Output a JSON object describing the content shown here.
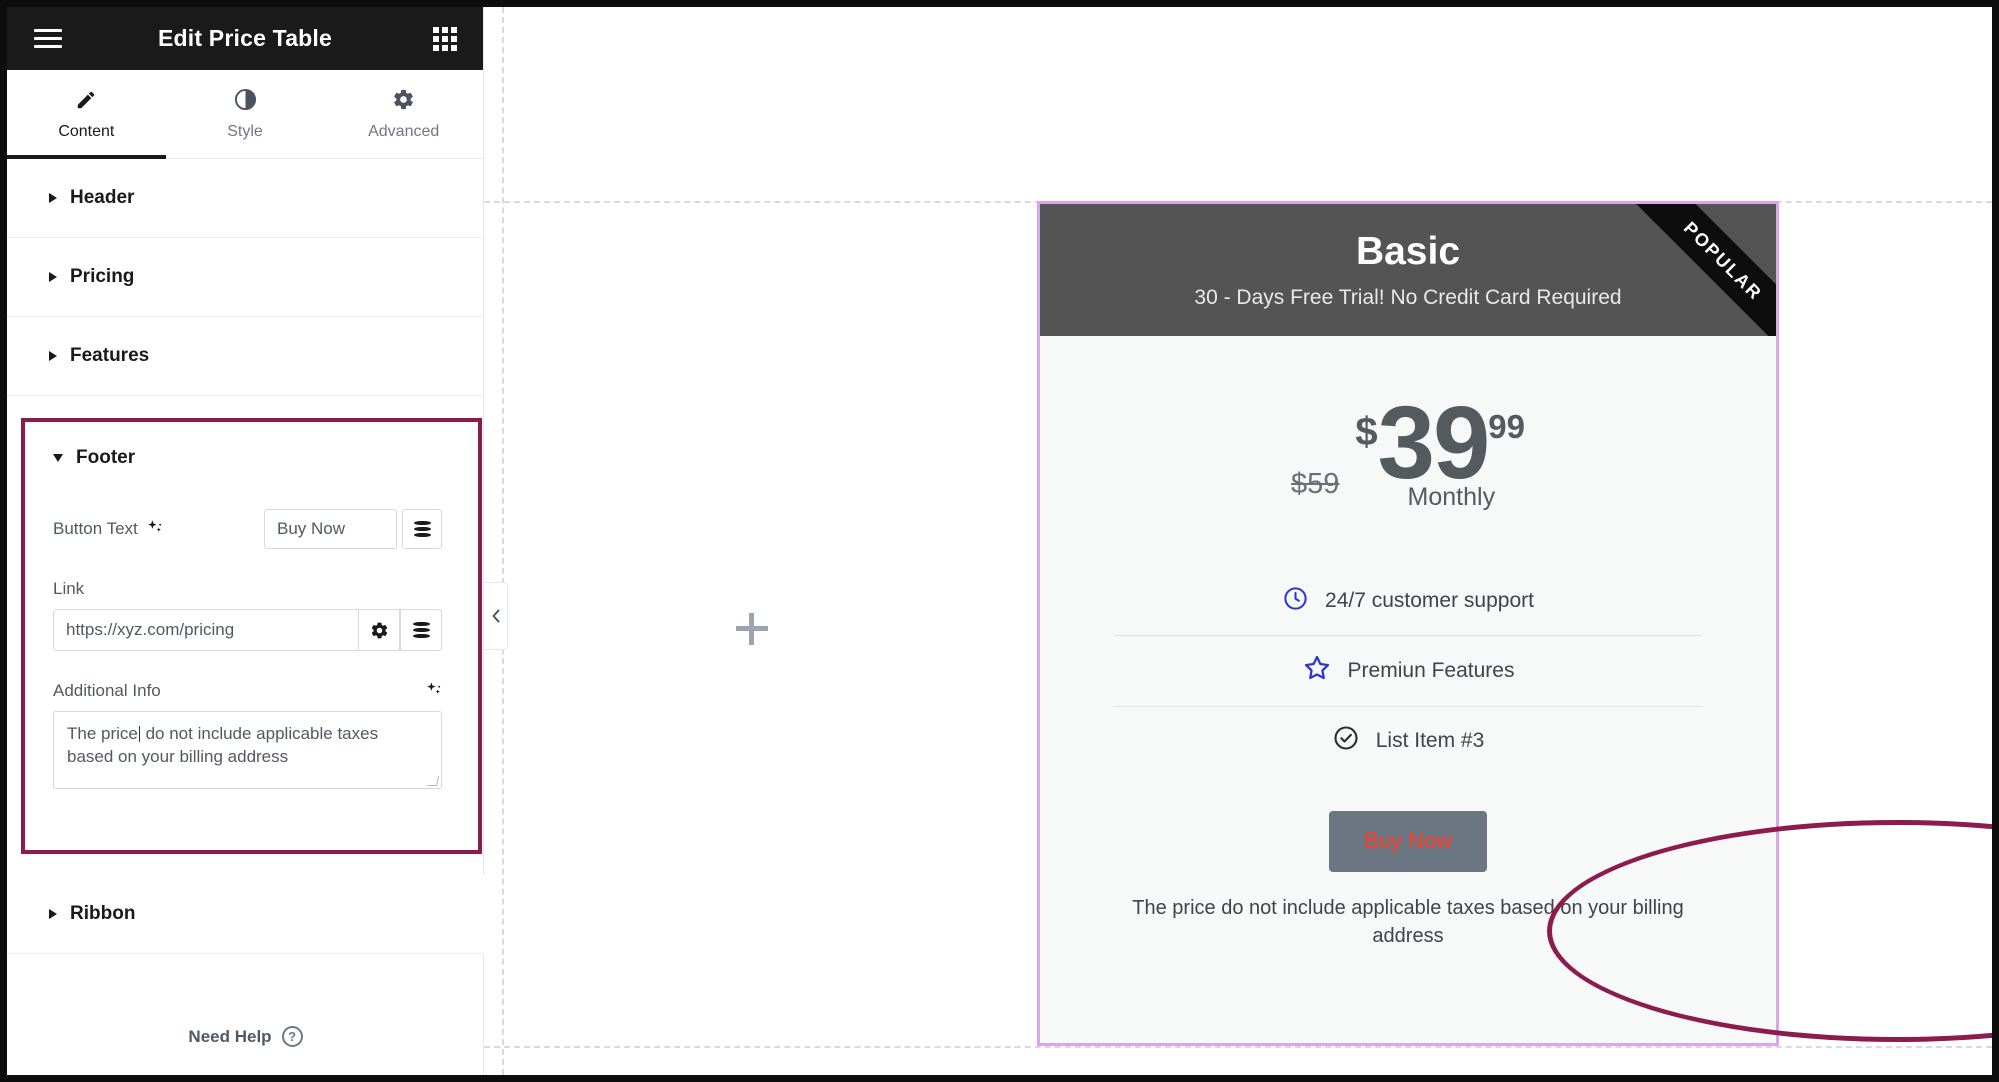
{
  "panel": {
    "title": "Edit Price Table",
    "menu_icon": "hamburger-icon",
    "apps_icon": "grid-icon",
    "tabs": [
      {
        "label": "Content",
        "icon": "pencil-icon",
        "active": true
      },
      {
        "label": "Style",
        "icon": "contrast-icon",
        "active": false
      },
      {
        "label": "Advanced",
        "icon": "gear-icon",
        "active": false
      }
    ],
    "sections": [
      {
        "label": "Header",
        "expanded": false
      },
      {
        "label": "Pricing",
        "expanded": false
      },
      {
        "label": "Features",
        "expanded": false
      },
      {
        "label": "Footer",
        "expanded": true
      },
      {
        "label": "Ribbon",
        "expanded": false
      }
    ],
    "footer_section": {
      "title": "Footer",
      "button_text": {
        "label": "Button Text",
        "value": "Buy Now",
        "ai_icon": "sparkle-icon",
        "tag_icon": "dynamic-tags-icon"
      },
      "link": {
        "label": "Link",
        "value": "https://xyz.com/pricing",
        "settings_icon": "gear-icon",
        "tag_icon": "dynamic-tags-icon"
      },
      "additional_info": {
        "label": "Additional Info",
        "ai_icon": "sparkle-icon",
        "value_before_caret": "The price",
        "value_after_caret": " do not include applicable taxes based on your billing address"
      }
    },
    "need_help": {
      "label": "Need Help",
      "icon": "question-circle-icon"
    }
  },
  "canvas": {
    "collapse_icon": "chevron-left-icon",
    "add_section_icon": "plus-icon"
  },
  "card": {
    "ribbon": "POPULAR",
    "title": "Basic",
    "subtitle": "30 - Days Free Trial! No Credit Card Required",
    "price": {
      "original": "$59",
      "currency": "$",
      "integer": "39",
      "fraction": "99",
      "period": "Monthly"
    },
    "features": [
      {
        "icon": "clock-icon",
        "label": "24/7 customer support"
      },
      {
        "icon": "star-icon",
        "label": "Premiun Features"
      },
      {
        "icon": "check-circle-icon",
        "label": "List Item #3"
      }
    ],
    "button_label": "Buy Now",
    "note": "The price do not include applicable taxes based on your billing address"
  },
  "colors": {
    "annotation": "#8c1c4e",
    "card_selection_border": "#dba5ec",
    "card_header_bg": "#545454",
    "button_bg": "#6c7682",
    "button_text": "#ff3b21",
    "feature_icon": "#2b35d6",
    "panel_header_bg": "#1a1a1a"
  }
}
